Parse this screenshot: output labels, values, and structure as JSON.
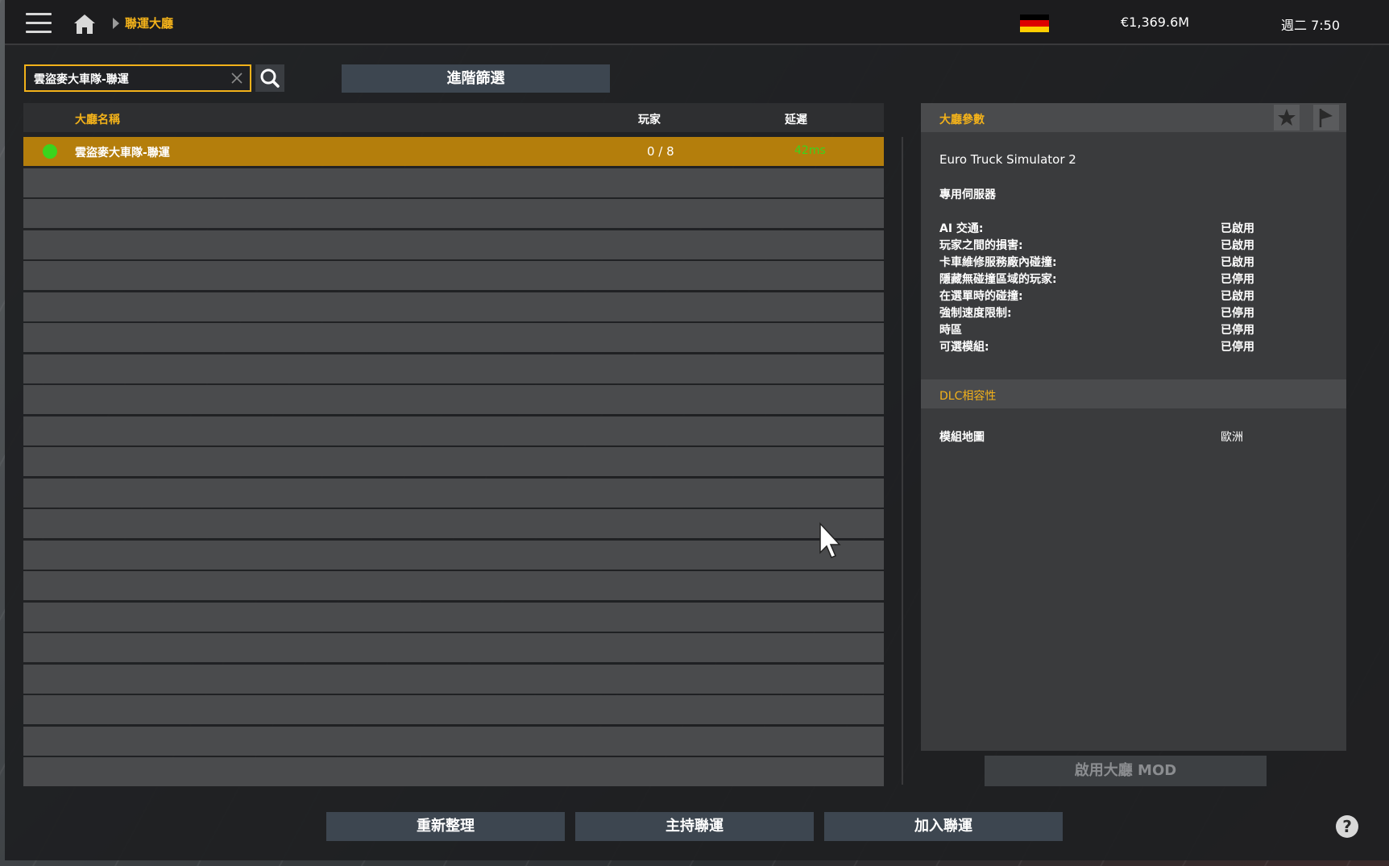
{
  "topbar": {
    "breadcrumb": "聯運大廳",
    "money": "€1,369.6M",
    "clock": "週二 7:50",
    "flag_colors": [
      "#000000",
      "#dd0000",
      "#ffce00"
    ]
  },
  "search": {
    "value": "雲盜麥大車隊-聯運"
  },
  "advanced_filter_label": "進階篩選",
  "table": {
    "headers": {
      "name": "大廳名稱",
      "players": "玩家",
      "ping": "延遲"
    },
    "rows": [
      {
        "name": "雲盜麥大車隊-聯運",
        "players": "0 / 8",
        "ping": "42ms",
        "status": "online"
      }
    ]
  },
  "panel": {
    "title": "大廳參數",
    "game": "Euro Truck Simulator 2",
    "server_type": "專用伺服器",
    "params": [
      {
        "label": "AI 交通:",
        "value": "已啟用"
      },
      {
        "label": "玩家之間的損害:",
        "value": "已啟用"
      },
      {
        "label": "卡車維修服務廠內碰撞:",
        "value": "已啟用"
      },
      {
        "label": "隱藏無碰撞區域的玩家:",
        "value": "已停用"
      },
      {
        "label": "在選單時的碰撞:",
        "value": "已啟用"
      },
      {
        "label": "強制速度限制:",
        "value": "已停用"
      },
      {
        "label": "時區",
        "value": "已停用"
      },
      {
        "label": "可選模組:",
        "value": "已停用"
      }
    ],
    "dlc_title": "DLC相容性",
    "dlc_rows": [
      {
        "label": "模組地圖",
        "value": "歐洲"
      }
    ]
  },
  "mod_button_label": "啟用大廳 MOD",
  "bottom_buttons": {
    "refresh": "重新整理",
    "host": "主持聯運",
    "join": "加入聯運"
  },
  "help_label": "?",
  "colors": {
    "accent": "#f3b21a",
    "selected_row": "#b47e0c",
    "ping_good": "#3bd41d"
  }
}
